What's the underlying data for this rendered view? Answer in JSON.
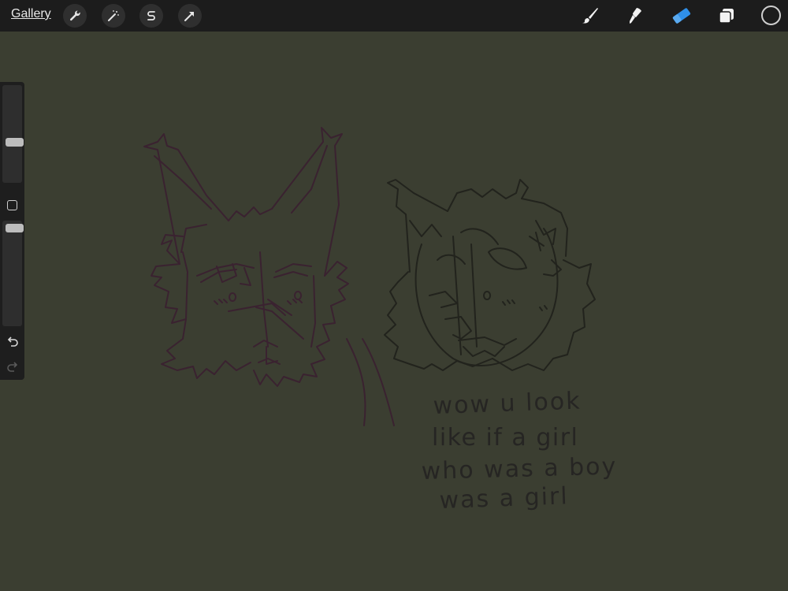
{
  "toolbar": {
    "gallery_label": "Gallery",
    "left_tools": [
      "wrench-icon",
      "magic-wand-icon",
      "selection-s-icon",
      "transform-arrow-icon"
    ],
    "right_tools": [
      "brush-icon",
      "smudge-icon",
      "eraser-icon",
      "layers-icon"
    ],
    "active_tool": "eraser-icon",
    "accent_color": "#2f8fe8",
    "current_color": "#1c1c1c"
  },
  "sidebar": {
    "brush_size_level": 0.4,
    "opacity_level": 1.0,
    "undo_icon": "undo-icon",
    "redo_icon": "redo-icon"
  },
  "canvas": {
    "background_color": "#3b3e31",
    "text_lines": [
      "wow u look",
      "like if a girl",
      "who was a boy",
      "was a girl"
    ]
  }
}
